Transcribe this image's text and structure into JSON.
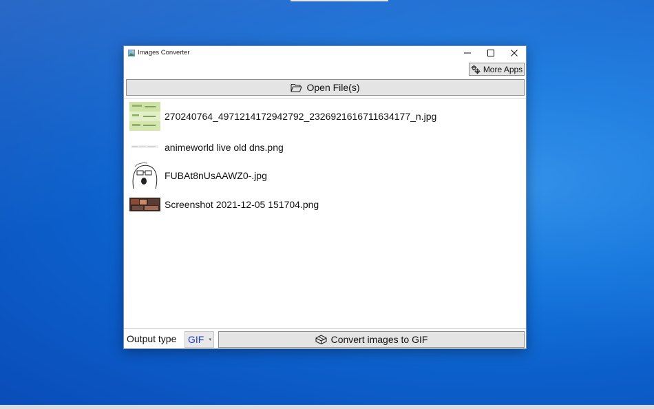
{
  "window": {
    "title": "Images Converter",
    "controls": {
      "minimize": "–",
      "maximize": "☐",
      "close": "✕"
    }
  },
  "toolbar": {
    "more_apps_label": "More Apps",
    "open_files_label": "Open File(s)"
  },
  "files": [
    {
      "name": "270240764_4971214172942792_2326921616711634177_n.jpg",
      "thumb": "green-document-thumb"
    },
    {
      "name": "animeworld live old dns.png",
      "thumb": "blank-page-thumb"
    },
    {
      "name": "FUBAt8nUsAAWZ0-.jpg",
      "thumb": "sketch-face-thumb"
    },
    {
      "name": "Screenshot 2021-12-05 151704.png",
      "thumb": "dark-screenshot-thumb"
    }
  ],
  "bottom": {
    "output_type_label": "Output type",
    "output_type_value": "GIF",
    "convert_label": "Convert images to GIF"
  },
  "icons": {
    "open": "folder-open-icon",
    "more_apps": "gear-cluster-icon",
    "convert": "box-icon"
  },
  "colors": {
    "desktop": "#0f66d0",
    "button_face": "#e4e4e4",
    "select_text": "#1f3cc2"
  }
}
